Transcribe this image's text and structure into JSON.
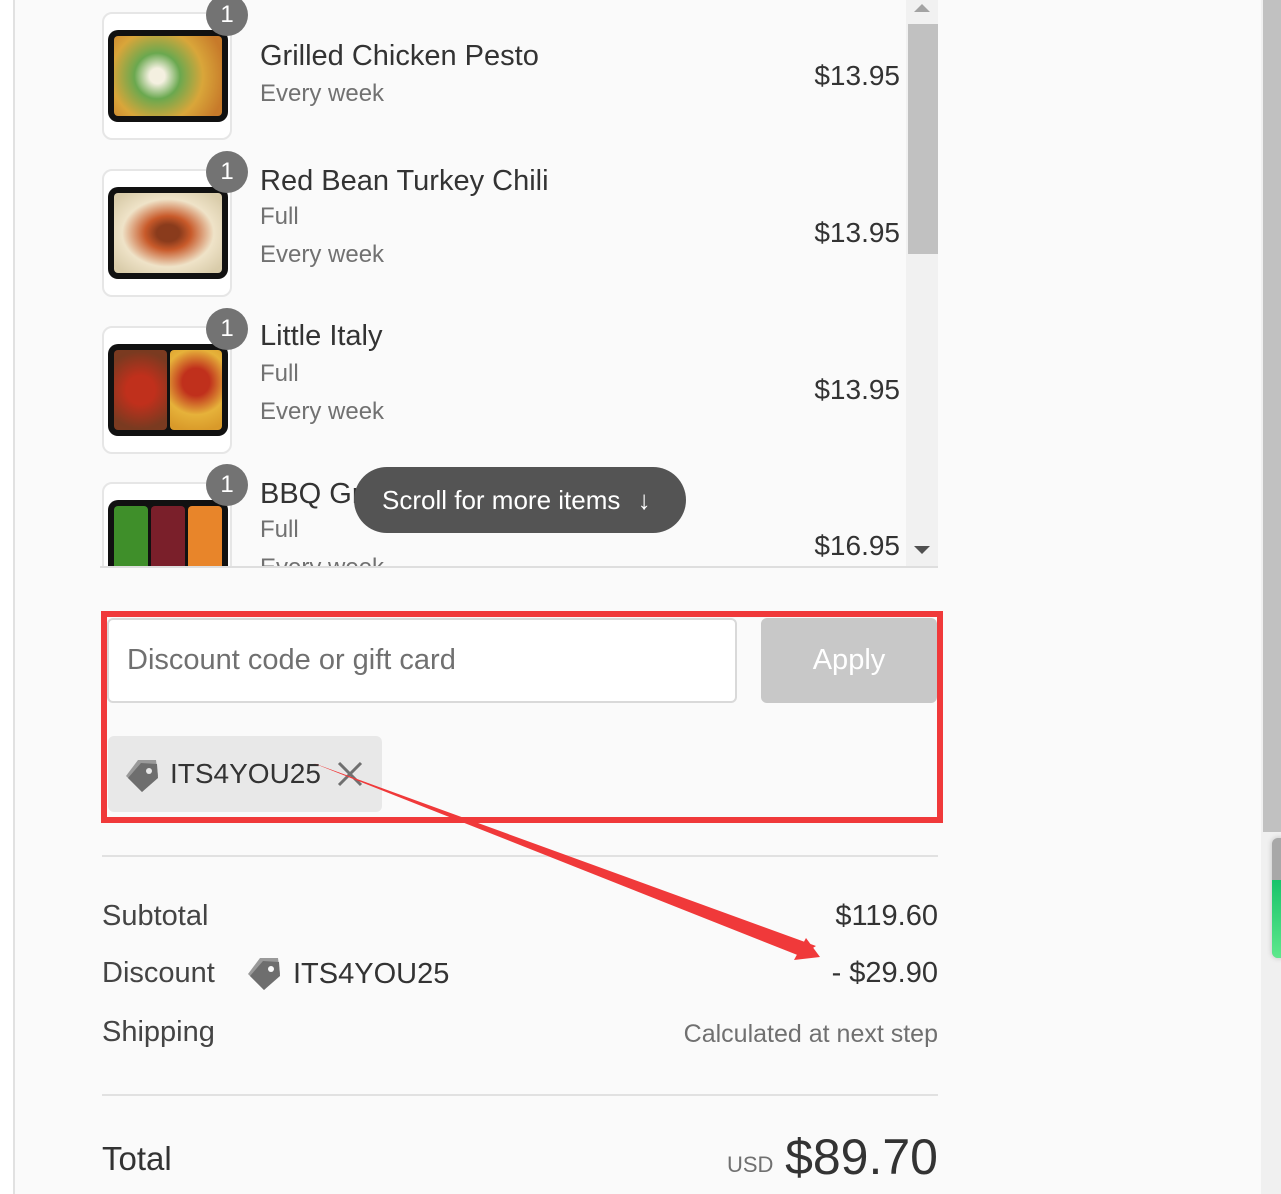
{
  "products": [
    {
      "name": "Grilled Chicken Pesto",
      "variant": null,
      "frequency": "Every week",
      "price": "$13.95",
      "quantity": "1",
      "image": "grilled-chicken-pesto-thumbnail"
    },
    {
      "name": "Red Bean Turkey Chili",
      "variant": "Full",
      "frequency": "Every week",
      "price": "$13.95",
      "quantity": "1",
      "image": "red-bean-turkey-chili-thumbnail"
    },
    {
      "name": "Little Italy",
      "variant": "Full",
      "frequency": "Every week",
      "price": "$13.95",
      "quantity": "1",
      "image": "little-italy-thumbnail"
    },
    {
      "name": "BBQ Grilled Steak",
      "variant": "Full",
      "frequency": "Every week",
      "price": "$16.95",
      "quantity": "1",
      "image": "bbq-grilled-steak-thumbnail"
    }
  ],
  "scroll_hint": {
    "label": "Scroll for more items",
    "icon": "arrow-down-icon"
  },
  "discount": {
    "placeholder": "Discount code or gift card",
    "value": "",
    "apply_label": "Apply",
    "applied_code": "ITS4YOU25",
    "tag_icon": "tag-icon",
    "remove_icon": "close-icon"
  },
  "summary": {
    "subtotal_label": "Subtotal",
    "subtotal_value": "$119.60",
    "discount_label": "Discount",
    "discount_code": "ITS4YOU25",
    "discount_value": "- $29.90",
    "shipping_label": "Shipping",
    "shipping_value": "Calculated at next step",
    "total_label": "Total",
    "total_currency": "USD",
    "total_value": "$89.70"
  },
  "annotation": {
    "color": "#f0393a"
  },
  "colors": {
    "background": "#fafafa",
    "badge": "#737373",
    "apply_disabled": "#c8c8c8",
    "chip": "#e8e8e8",
    "scroll_hint_bg": "#545454"
  }
}
